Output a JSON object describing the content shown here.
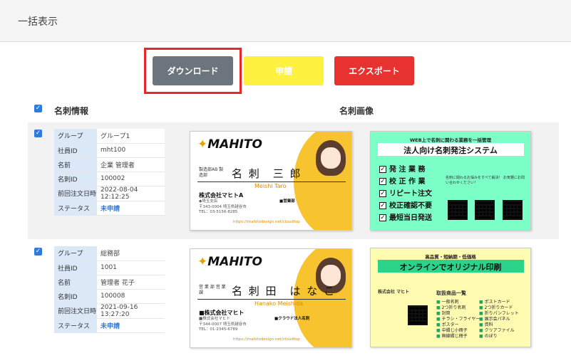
{
  "panel": {
    "title": "一括表示"
  },
  "actions": {
    "download": "ダウンロード",
    "apply": "申請",
    "export": "エクスポート"
  },
  "columns": {
    "info": "名刺情報",
    "image": "名刺画像"
  },
  "field_labels": [
    "グループ",
    "社員ID",
    "名前",
    "名刺ID",
    "前回注文日時",
    "ステータス"
  ],
  "rows": [
    {
      "values": [
        "グループ1",
        "mht100",
        "企業 管理者",
        "100002",
        "2022-08-04 12:12:25",
        "未申請"
      ],
      "card": {
        "logo": "MAHITO",
        "dept": "製造部AB 製造部",
        "name": "名 刺　三 郎",
        "romaji": "Meishi Taro",
        "company": "株式会社マヒトA",
        "branch": "◆埼玉支店",
        "address": "〒343-0004 埼玉県越谷市",
        "tel": "TEL：03-5156-8285",
        "office": "■営業部",
        "url": "https://mahitodesign.net/cloudtop"
      },
      "ad": {
        "small": "WEB上で名刺に関わる業務を一括管理",
        "title": "法人向け名刺発注システム",
        "checks": [
          "発 注 業 務",
          "校 正 作 業",
          "リピート注文",
          "校正確認不要",
          "最短当日発送"
        ],
        "note": "名刺に関わるお悩みをすべて解決！ お気軽にお問い合わせください！"
      }
    },
    {
      "values": [
        "総務部",
        "1001",
        "管理者 花子",
        "100008",
        "2021-09-16 13:27:20",
        "未申請"
      ],
      "card": {
        "logo": "MAHITO",
        "dept": "営 業 部 営 業 課",
        "name": "名 刺 田　は な こ",
        "romaji": "Hanako Meishida",
        "company": "■株式会社マヒト",
        "branch": "■株式会社マヒト",
        "address": "〒344-0007 埼玉県越谷市",
        "tel": "TEL：01-2345-6789",
        "office": "■クラウド法人名刺",
        "url": "https://mahitodesign.net/cloudtop"
      },
      "ad": {
        "small": "高品質・短納期・低価格",
        "title": "オンラインでオリジナル印刷",
        "company": "株式会社 マヒト",
        "list_title": "取扱商品一覧",
        "items_left": [
          "一般名刺",
          "2つ折り名刺",
          "封筒",
          "チラシ・フライヤー",
          "ポスター",
          "中綴じ小冊子",
          "無線綴じ冊子"
        ],
        "items_right": [
          "ポストカード",
          "2つ折りカード",
          "折りパンフレット",
          "展示会パネル",
          "資料",
          "クリアファイル",
          "のぼり"
        ]
      }
    }
  ],
  "colors": {
    "download": "#6c757d",
    "apply": "#fff140",
    "export": "#e7322f",
    "highlight": "#e8262d",
    "status": "#2f7bdc"
  }
}
